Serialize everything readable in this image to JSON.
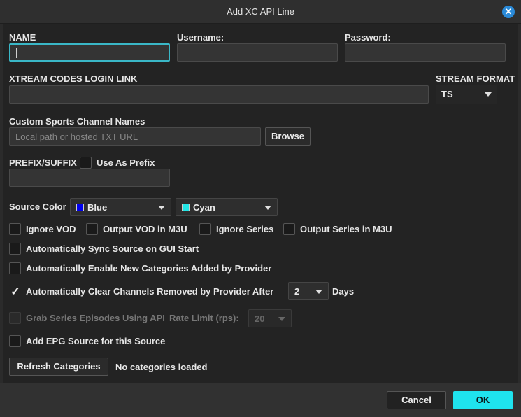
{
  "window": {
    "title": "Add XC API Line"
  },
  "fields": {
    "name_label": "NAME",
    "username_label": "Username:",
    "password_label": "Password:",
    "login_link_label": "XTREAM CODES LOGIN LINK",
    "stream_format_label": "STREAM FORMAT",
    "stream_format_value": "TS",
    "custom_sports_label": "Custom Sports Channel Names",
    "custom_sports_placeholder": "Local path or hosted TXT URL",
    "browse_label": "Browse",
    "prefix_suffix_label": "PREFIX/SUFFIX",
    "use_as_prefix_label": "Use As Prefix"
  },
  "source_color": {
    "label": "Source Color",
    "primary": {
      "name": "Blue",
      "color": "#0000ee"
    },
    "secondary": {
      "name": "Cyan",
      "color": "#22e5e5"
    }
  },
  "options": {
    "ignore_vod": "Ignore VOD",
    "output_vod": "Output VOD in M3U",
    "ignore_series": "Ignore Series",
    "output_series": "Output Series in M3U",
    "auto_sync": "Automatically Sync Source on GUI Start",
    "auto_enable": "Automatically Enable New Categories Added by Provider",
    "auto_clear": "Automatically Clear Channels Removed by Provider After",
    "auto_clear_days_value": "2",
    "days_label": "Days",
    "grab_series": "Grab Series Episodes Using API",
    "rate_limit_label": "Rate Limit (rps):",
    "rate_limit_value": "20",
    "add_epg": "Add EPG Source for this Source"
  },
  "categories": {
    "refresh_label": "Refresh Categories",
    "status": "No categories loaded"
  },
  "footer": {
    "cancel_label": "Cancel",
    "ok_label": "OK"
  },
  "colors": {
    "accent": "#1fe3ee",
    "close_icon": "#2a8ad8",
    "focus": "#3ab7c7"
  },
  "icons": {
    "close": "close-icon",
    "dropdown": "chevron-down-icon",
    "check": "check-icon"
  }
}
